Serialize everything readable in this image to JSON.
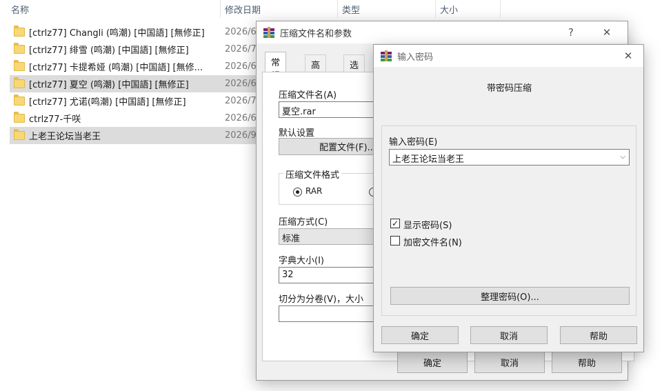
{
  "explorer": {
    "columns": {
      "name": "名称",
      "date": "修改日期",
      "type": "类型",
      "size": "大小"
    },
    "files": [
      {
        "name": "[ctrlz77] Changli (鸣潮) [中国語] [無修正]",
        "date": "2026/6",
        "selected": false
      },
      {
        "name": "[ctrlz77] 绯雪 (鸣潮) [中国語] [無修正]",
        "date": "2026/7",
        "selected": false
      },
      {
        "name": "[ctrlz77] 卡提希娅 (鸣潮) [中国語] [無修...",
        "date": "2026/6",
        "selected": false
      },
      {
        "name": "[ctrlz77] 夏空 (鸣潮) [中国語] [無修正]",
        "date": "2026/6",
        "selected": true
      },
      {
        "name": "[ctrlz77] 尤诺(鸣潮) [中国語] [無修正]",
        "date": "2026/7",
        "selected": false
      },
      {
        "name": "ctrlz77-千咲",
        "date": "2026/6",
        "selected": false
      },
      {
        "name": "上老王论坛当老王",
        "date": "2026/9",
        "selected": true
      }
    ]
  },
  "archive_dialog": {
    "title": "压缩文件名和参数",
    "help_glyph": "?",
    "close_glyph": "✕",
    "tabs": [
      "常规",
      "高级",
      "选项"
    ],
    "archive_name_label": "压缩文件名(A)",
    "archive_name_value": "夏空.rar",
    "default_settings_label": "默认设置",
    "profiles_button": "配置文件(F)...",
    "format_group": "压缩文件格式",
    "format_rar": "RAR",
    "method_label": "压缩方式(C)",
    "method_value": "标准",
    "dict_label": "字典大小(I)",
    "dict_value": "32",
    "split_label": "切分为分卷(V)，大小",
    "split_value": "",
    "ok": "确定",
    "cancel": "取消",
    "help": "帮助"
  },
  "password_dialog": {
    "title": "输入密码",
    "close_glyph": "✕",
    "heading": "带密码压缩",
    "enter_label": "输入密码(E)",
    "password_value": "上老王论坛当老王",
    "show_password_label": "显示密码(S)",
    "show_password_checked": true,
    "encrypt_names_label": "加密文件名(N)",
    "encrypt_names_checked": false,
    "organize_button": "整理密码(O)...",
    "ok": "确定",
    "cancel": "取消",
    "help": "帮助"
  },
  "colors": {
    "selected_row": "#dcdcdc",
    "folder": "#f8d775",
    "dialog_bg": "#f0f0f0"
  }
}
